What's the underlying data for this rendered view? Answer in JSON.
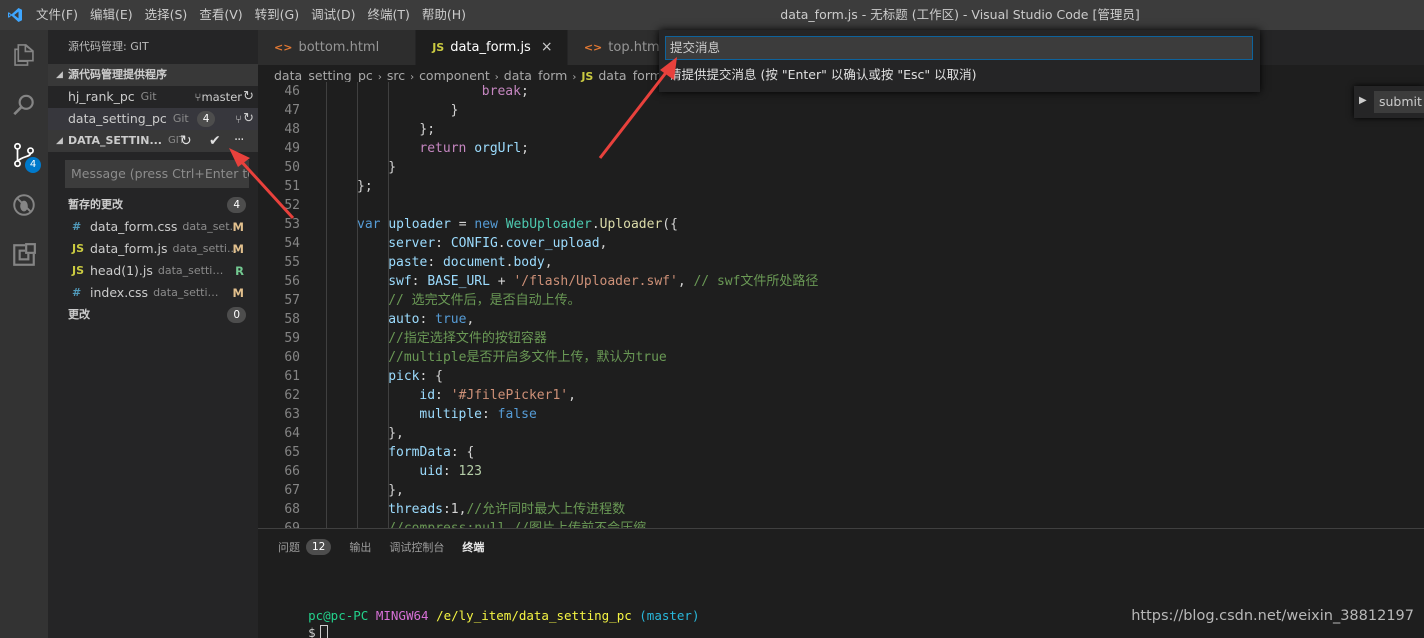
{
  "titlebar": {
    "menu": [
      "文件(F)",
      "编辑(E)",
      "选择(S)",
      "查看(V)",
      "转到(G)",
      "调试(D)",
      "终端(T)",
      "帮助(H)"
    ],
    "window_title": "data_form.js - 无标题 (工作区) - Visual Studio Code [管理员]"
  },
  "activitybar": {
    "scm_badge": "4"
  },
  "sidebar": {
    "title": "源代码管理: GIT",
    "providers_title": "源代码管理提供程序",
    "repos": [
      {
        "name": "hj_rank_pc",
        "kind": "Git",
        "branch": "master"
      },
      {
        "name": "data_setting_pc",
        "kind": "Git",
        "count": "4"
      }
    ],
    "scm": {
      "repo_title": "DATA_SETTIN...",
      "kind": "GIT",
      "more": "···",
      "message_placeholder": "Message (press Ctrl+Enter to commit)",
      "staged_title": "暂存的更改",
      "staged_count": "4",
      "staged_files": [
        {
          "icon": "#",
          "icon_color": "#519aba",
          "name": "data_form.css",
          "path": "data_set...",
          "status": "M",
          "status_color": "#e2c08d"
        },
        {
          "icon": "JS",
          "icon_color": "#cbcb41",
          "name": "data_form.js",
          "path": "data_setti...",
          "status": "M",
          "status_color": "#e2c08d"
        },
        {
          "icon": "JS",
          "icon_color": "#cbcb41",
          "name": "head(1).js",
          "path": "data_setting_...",
          "status": "R",
          "status_color": "#73c991"
        },
        {
          "icon": "#",
          "icon_color": "#519aba",
          "name": "index.css",
          "path": "data_setting_...",
          "status": "M",
          "status_color": "#e2c08d"
        }
      ],
      "changes_title": "更改",
      "changes_count": "0"
    }
  },
  "tabs": [
    {
      "icon": "<>",
      "icon_color": "#e37933",
      "label": "bottom.html",
      "active": false
    },
    {
      "icon": "JS",
      "icon_color": "#cbcb41",
      "label": "data_form.js",
      "active": true,
      "close": "×"
    },
    {
      "icon": "<>",
      "icon_color": "#e37933",
      "label": "top.html",
      "active": false
    }
  ],
  "breadcrumbs": {
    "parts": [
      "data_setting_pc",
      "src",
      "component",
      "data_form"
    ],
    "file_icon": "JS",
    "file": "data_form.js"
  },
  "quick_input": {
    "placeholder": "提交消息",
    "message": "请提供提交消息 (按 \"Enter\" 以确认或按 \"Esc\" 以取消)"
  },
  "submit_button": "submit",
  "code_lines": [
    {
      "n": "46",
      "indent": 16,
      "tokens": [
        [
          "kw2",
          "break"
        ],
        [
          "p",
          ";"
        ]
      ]
    },
    {
      "n": "47",
      "indent": 12,
      "tokens": [
        [
          "p",
          "}"
        ]
      ]
    },
    {
      "n": "48",
      "indent": 8,
      "tokens": [
        [
          "p",
          "};"
        ]
      ]
    },
    {
      "n": "49",
      "indent": 8,
      "tokens": [
        [
          "kw2",
          "return"
        ],
        [
          "p",
          " "
        ],
        [
          "var",
          "orgUrl"
        ],
        [
          "p",
          ";"
        ]
      ]
    },
    {
      "n": "50",
      "indent": 4,
      "tokens": [
        [
          "p",
          "}"
        ]
      ]
    },
    {
      "n": "51",
      "indent": 0,
      "tokens": [
        [
          "p",
          "};"
        ]
      ]
    },
    {
      "n": "52",
      "indent": 0,
      "tokens": []
    },
    {
      "n": "53",
      "indent": 0,
      "tokens": [
        [
          "kw",
          "var"
        ],
        [
          "p",
          " "
        ],
        [
          "var",
          "uploader"
        ],
        [
          "p",
          " = "
        ],
        [
          "kw",
          "new"
        ],
        [
          "p",
          " "
        ],
        [
          "cls",
          "WebUploader"
        ],
        [
          "p",
          "."
        ],
        [
          "fn",
          "Uploader"
        ],
        [
          "p",
          "({"
        ]
      ]
    },
    {
      "n": "54",
      "indent": 4,
      "tokens": [
        [
          "var",
          "server"
        ],
        [
          "p",
          ": "
        ],
        [
          "var",
          "CONFIG"
        ],
        [
          "p",
          "."
        ],
        [
          "var",
          "cover_upload"
        ],
        [
          "p",
          ","
        ]
      ]
    },
    {
      "n": "55",
      "indent": 4,
      "tokens": [
        [
          "var",
          "paste"
        ],
        [
          "p",
          ": "
        ],
        [
          "var",
          "document"
        ],
        [
          "p",
          "."
        ],
        [
          "var",
          "body"
        ],
        [
          "p",
          ","
        ]
      ]
    },
    {
      "n": "56",
      "indent": 4,
      "tokens": [
        [
          "var",
          "swf"
        ],
        [
          "p",
          ": "
        ],
        [
          "var",
          "BASE_URL"
        ],
        [
          "p",
          " + "
        ],
        [
          "str",
          "'/flash/Uploader.swf'"
        ],
        [
          "p",
          ", "
        ],
        [
          "cm",
          "// swf文件所处路径"
        ]
      ]
    },
    {
      "n": "57",
      "indent": 4,
      "tokens": [
        [
          "cm",
          "// 选完文件后，是否自动上传。"
        ]
      ]
    },
    {
      "n": "58",
      "indent": 4,
      "tokens": [
        [
          "var",
          "auto"
        ],
        [
          "p",
          ": "
        ],
        [
          "kw",
          "true"
        ],
        [
          "p",
          ","
        ]
      ]
    },
    {
      "n": "59",
      "indent": 4,
      "tokens": [
        [
          "cm",
          "//指定选择文件的按钮容器"
        ]
      ]
    },
    {
      "n": "60",
      "indent": 4,
      "tokens": [
        [
          "cm",
          "//multiple是否开启多文件上传，默认为true"
        ]
      ]
    },
    {
      "n": "61",
      "indent": 4,
      "tokens": [
        [
          "var",
          "pick"
        ],
        [
          "p",
          ": {"
        ]
      ]
    },
    {
      "n": "62",
      "indent": 8,
      "tokens": [
        [
          "var",
          "id"
        ],
        [
          "p",
          ": "
        ],
        [
          "str",
          "'#JfilePicker1'"
        ],
        [
          "p",
          ","
        ]
      ]
    },
    {
      "n": "63",
      "indent": 8,
      "tokens": [
        [
          "var",
          "multiple"
        ],
        [
          "p",
          ": "
        ],
        [
          "kw",
          "false"
        ]
      ]
    },
    {
      "n": "64",
      "indent": 4,
      "tokens": [
        [
          "p",
          "},"
        ]
      ]
    },
    {
      "n": "65",
      "indent": 4,
      "tokens": [
        [
          "var",
          "formData"
        ],
        [
          "p",
          ": {"
        ]
      ]
    },
    {
      "n": "66",
      "indent": 8,
      "tokens": [
        [
          "var",
          "uid"
        ],
        [
          "p",
          ": "
        ],
        [
          "num",
          "123"
        ]
      ]
    },
    {
      "n": "67",
      "indent": 4,
      "tokens": [
        [
          "p",
          "},"
        ]
      ]
    },
    {
      "n": "68",
      "indent": 4,
      "tokens": [
        [
          "var",
          "threads"
        ],
        [
          "p",
          ":1,"
        ],
        [
          "cm",
          "//允许同时最大上传进程数"
        ]
      ]
    },
    {
      "n": "69",
      "indent": 4,
      "tokens": [
        [
          "cm",
          "//compress:null,//图片上传前不会压缩"
        ]
      ]
    }
  ],
  "panel": {
    "tabs": [
      {
        "label": "问题",
        "count": "12",
        "active": false
      },
      {
        "label": "输出",
        "active": false
      },
      {
        "label": "调试控制台",
        "active": false
      },
      {
        "label": "终端",
        "active": true
      }
    ],
    "terminal": {
      "user": "pc@pc-PC",
      "shell": "MINGW64",
      "path": "/e/ly_item/data_setting_pc",
      "branch": "(master)",
      "prompt": "$"
    }
  },
  "watermark": "https://blog.csdn.net/weixin_38812197",
  "colors": {
    "accent": "#007acc",
    "annotation_arrow": "#e8413c"
  }
}
